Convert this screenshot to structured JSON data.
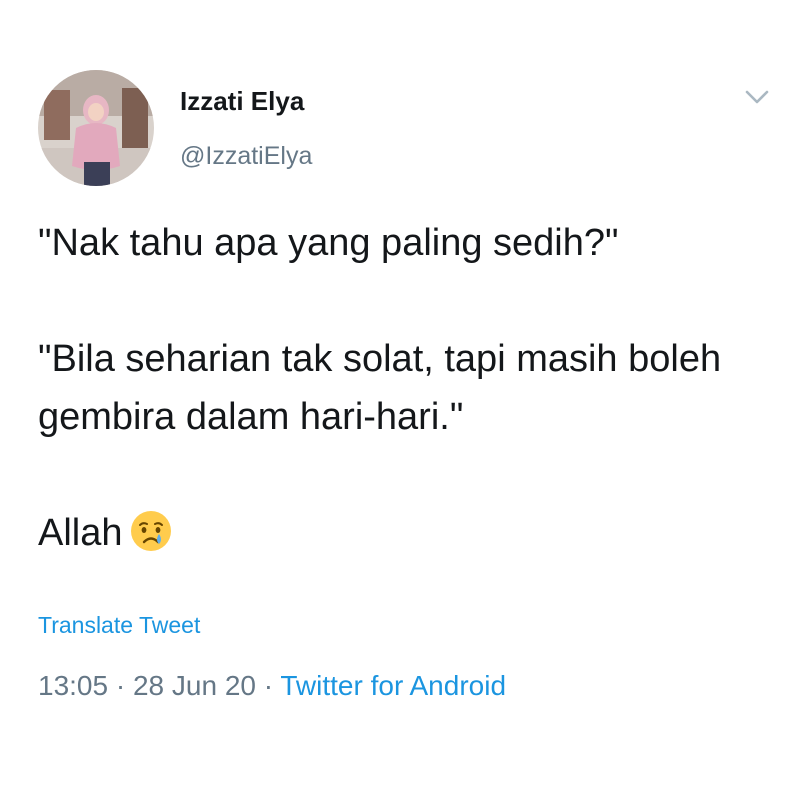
{
  "author": {
    "display_name": "Izzati Elya",
    "handle": "@IzzatiElya"
  },
  "tweet": {
    "line1": "\"Nak tahu apa yang paling sedih?\"",
    "line2": "\"Bila seharian tak solat, tapi masih boleh gembira dalam hari-hari.\"",
    "line3": "Allah",
    "emoji": "crying-face-emoji"
  },
  "translate_label": "Translate Tweet",
  "meta": {
    "time": "13:05",
    "separator": "·",
    "date": "28 Jun 20",
    "source": "Twitter for Android"
  },
  "colors": {
    "link": "#1b95e0",
    "secondary_text": "#657786",
    "primary_text": "#14171a"
  },
  "icons": {
    "more_options": "chevron-down-icon"
  }
}
